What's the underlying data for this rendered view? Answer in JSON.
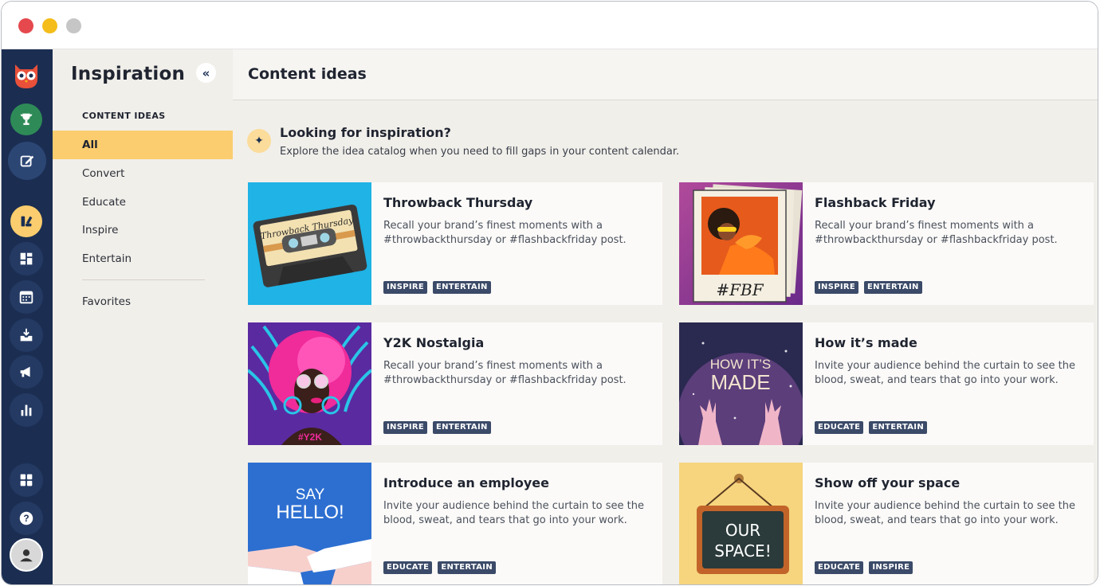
{
  "window": {
    "controls": [
      "close",
      "minimize",
      "maximize"
    ]
  },
  "rail": {
    "items": [
      {
        "name": "owl-logo-icon",
        "active": false
      },
      {
        "name": "trophy-icon",
        "active": false
      },
      {
        "name": "compose-icon",
        "active": false
      },
      {
        "name": "inspiration-icon",
        "active": true
      },
      {
        "name": "dashboard-icon",
        "active": false
      },
      {
        "name": "calendar-icon",
        "active": false
      },
      {
        "name": "inbox-icon",
        "active": false
      },
      {
        "name": "megaphone-icon",
        "active": false
      },
      {
        "name": "analytics-icon",
        "active": false
      },
      {
        "name": "apps-icon",
        "active": false
      },
      {
        "name": "help-icon",
        "active": false
      },
      {
        "name": "profile-icon",
        "active": false
      }
    ]
  },
  "sidebar": {
    "title": "Inspiration",
    "collapse_glyph": "«",
    "section_label": "CONTENT IDEAS",
    "items": [
      {
        "label": "All",
        "active": true
      },
      {
        "label": "Convert",
        "active": false
      },
      {
        "label": "Educate",
        "active": false
      },
      {
        "label": "Inspire",
        "active": false
      },
      {
        "label": "Entertain",
        "active": false
      }
    ],
    "favorites_label": "Favorites"
  },
  "main": {
    "title": "Content ideas",
    "banner": {
      "title": "Looking for inspiration?",
      "subtitle": "Explore the idea catalog when you need to fill gaps in your content calendar."
    },
    "cards": [
      {
        "title": "Throwback Thursday",
        "description": "Recall your brand’s finest moments with a #throwbackthursday or #flashbackfriday post.",
        "tags": [
          "INSPIRE",
          "ENTERTAIN"
        ],
        "thumb_text": "Throwback Thursday"
      },
      {
        "title": "Flashback Friday",
        "description": "Recall your brand’s finest moments with a #throwbackthursday or #flashbackfriday post.",
        "tags": [
          "INSPIRE",
          "ENTERTAIN"
        ],
        "thumb_text": "#FBF"
      },
      {
        "title": "Y2K Nostalgia",
        "description": "Recall your brand’s finest moments with a #throwbackthursday or #flashbackfriday post.",
        "tags": [
          "INSPIRE",
          "ENTERTAIN"
        ],
        "thumb_text": "#Y2K"
      },
      {
        "title": "How it’s made",
        "description": "Invite your audience behind the curtain to see the blood, sweat, and tears that go into your work.",
        "tags": [
          "EDUCATE",
          "ENTERTAIN"
        ],
        "thumb_text_line1": "HOW IT’S",
        "thumb_text_line2": "MADE"
      },
      {
        "title": "Introduce an employee",
        "description": "Invite your audience behind the curtain to see the blood, sweat, and tears that go into your work.",
        "tags": [
          "EDUCATE",
          "ENTERTAIN"
        ],
        "thumb_text_line1": "SAY",
        "thumb_text_line2": "HELLO!"
      },
      {
        "title": "Show off your space",
        "description": "Invite your audience behind the curtain to see the blood, sweat, and tears that go into your work.",
        "tags": [
          "EDUCATE",
          "INSPIRE"
        ],
        "thumb_text_line1": "OUR",
        "thumb_text_line2": "SPACE!"
      }
    ]
  },
  "colors": {
    "rail_bg": "#1b2e52",
    "sidebar_bg": "#f1efea",
    "active_item": "#fbcd6e",
    "tag_bg": "#3b4a68",
    "owl_red": "#e8503a",
    "trophy_green": "#2e8b57",
    "active_rail_yellow": "#fbcd6e"
  }
}
